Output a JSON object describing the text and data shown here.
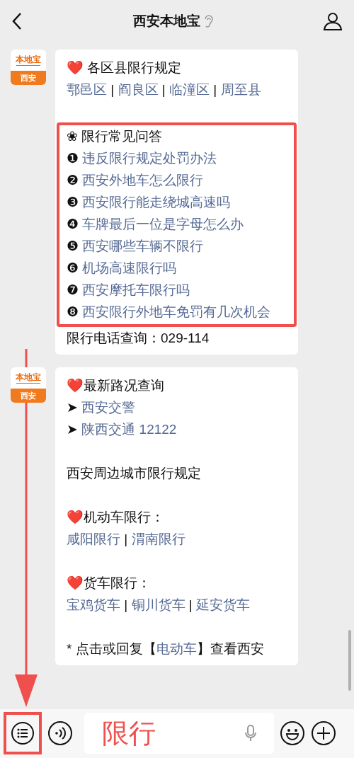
{
  "header": {
    "title": "西安本地宝"
  },
  "messages": [
    {
      "avatar": {
        "brand": "本地宝",
        "city": "西安"
      },
      "blocks": [
        {
          "framed": false,
          "lines": [
            {
              "kind": "text",
              "segments": [
                {
                  "text": "❤️",
                  "kind": "heart"
                },
                {
                  "text": " 各区县限行规定",
                  "kind": "plain"
                }
              ]
            },
            {
              "kind": "text",
              "segments": [
                {
                  "text": "鄠邑区",
                  "kind": "link"
                },
                {
                  "text": " | ",
                  "kind": "plain"
                },
                {
                  "text": "阎良区",
                  "kind": "link"
                },
                {
                  "text": " | ",
                  "kind": "plain"
                },
                {
                  "text": "临潼区",
                  "kind": "link"
                },
                {
                  "text": " | ",
                  "kind": "plain"
                },
                {
                  "text": "周至县",
                  "kind": "link"
                }
              ]
            },
            {
              "kind": "blank"
            }
          ]
        },
        {
          "framed": true,
          "lines": [
            {
              "kind": "text",
              "segments": [
                {
                  "text": "❀ 限行常见问答",
                  "kind": "plain"
                }
              ]
            },
            {
              "kind": "text",
              "segments": [
                {
                  "text": "❶ ",
                  "kind": "plain"
                },
                {
                  "text": "违反限行规定处罚办法",
                  "kind": "link"
                }
              ]
            },
            {
              "kind": "text",
              "segments": [
                {
                  "text": "❷ ",
                  "kind": "plain"
                },
                {
                  "text": "西安外地车怎么限行",
                  "kind": "link"
                }
              ]
            },
            {
              "kind": "text",
              "segments": [
                {
                  "text": "❸ ",
                  "kind": "plain"
                },
                {
                  "text": "西安限行能走绕城高速吗",
                  "kind": "link"
                }
              ]
            },
            {
              "kind": "text",
              "segments": [
                {
                  "text": "❹ ",
                  "kind": "plain"
                },
                {
                  "text": "车牌最后一位是字母怎么办",
                  "kind": "link"
                }
              ]
            },
            {
              "kind": "text",
              "segments": [
                {
                  "text": "❺ ",
                  "kind": "plain"
                },
                {
                  "text": "西安哪些车辆不限行",
                  "kind": "link"
                }
              ]
            },
            {
              "kind": "text",
              "segments": [
                {
                  "text": "❻ ",
                  "kind": "plain"
                },
                {
                  "text": "机场高速限行吗",
                  "kind": "link"
                }
              ]
            },
            {
              "kind": "text",
              "segments": [
                {
                  "text": "❼ ",
                  "kind": "plain"
                },
                {
                  "text": "西安摩托车限行吗",
                  "kind": "link"
                }
              ]
            },
            {
              "kind": "text",
              "segments": [
                {
                  "text": "❽ ",
                  "kind": "plain"
                },
                {
                  "text": "西安限行外地车免罚有几次机会",
                  "kind": "link"
                }
              ]
            }
          ]
        },
        {
          "framed": false,
          "lines": [
            {
              "kind": "text",
              "segments": [
                {
                  "text": "限行电话查询：029-114",
                  "kind": "plain"
                }
              ]
            }
          ]
        }
      ]
    },
    {
      "avatar": {
        "brand": "本地宝",
        "city": "西安"
      },
      "blocks": [
        {
          "framed": false,
          "lines": [
            {
              "kind": "text",
              "segments": [
                {
                  "text": "❤️",
                  "kind": "heart"
                },
                {
                  "text": "最新路况查询",
                  "kind": "plain"
                }
              ]
            },
            {
              "kind": "text",
              "segments": [
                {
                  "text": "➤ ",
                  "kind": "plain"
                },
                {
                  "text": "西安交警",
                  "kind": "link"
                }
              ]
            },
            {
              "kind": "text",
              "segments": [
                {
                  "text": "➤ ",
                  "kind": "plain"
                },
                {
                  "text": "陕西交通 12122",
                  "kind": "link"
                }
              ]
            },
            {
              "kind": "blank"
            },
            {
              "kind": "text",
              "segments": [
                {
                  "text": "西安周边城市限行规定",
                  "kind": "plain"
                }
              ]
            },
            {
              "kind": "blank"
            },
            {
              "kind": "text",
              "segments": [
                {
                  "text": "❤️",
                  "kind": "heart"
                },
                {
                  "text": "机动车限行：",
                  "kind": "plain"
                }
              ]
            },
            {
              "kind": "text",
              "segments": [
                {
                  "text": "咸阳限行",
                  "kind": "link"
                },
                {
                  "text": " | ",
                  "kind": "plain"
                },
                {
                  "text": "渭南限行",
                  "kind": "link"
                }
              ]
            },
            {
              "kind": "blank"
            },
            {
              "kind": "text",
              "segments": [
                {
                  "text": "❤️",
                  "kind": "heart"
                },
                {
                  "text": "货车限行：",
                  "kind": "plain"
                }
              ]
            },
            {
              "kind": "text",
              "segments": [
                {
                  "text": "宝鸡货车",
                  "kind": "link"
                },
                {
                  "text": " | ",
                  "kind": "plain"
                },
                {
                  "text": "铜川货车",
                  "kind": "link"
                },
                {
                  "text": " | ",
                  "kind": "plain"
                },
                {
                  "text": "延安货车",
                  "kind": "link"
                }
              ]
            },
            {
              "kind": "blank"
            },
            {
              "kind": "text",
              "segments": [
                {
                  "text": "* 点击或回复【",
                  "kind": "plain"
                },
                {
                  "text": "电动车",
                  "kind": "link"
                },
                {
                  "text": "】查看西安",
                  "kind": "plain"
                }
              ]
            }
          ]
        }
      ]
    }
  ],
  "input_bar": {
    "menu_framed": true,
    "value": "限行"
  }
}
